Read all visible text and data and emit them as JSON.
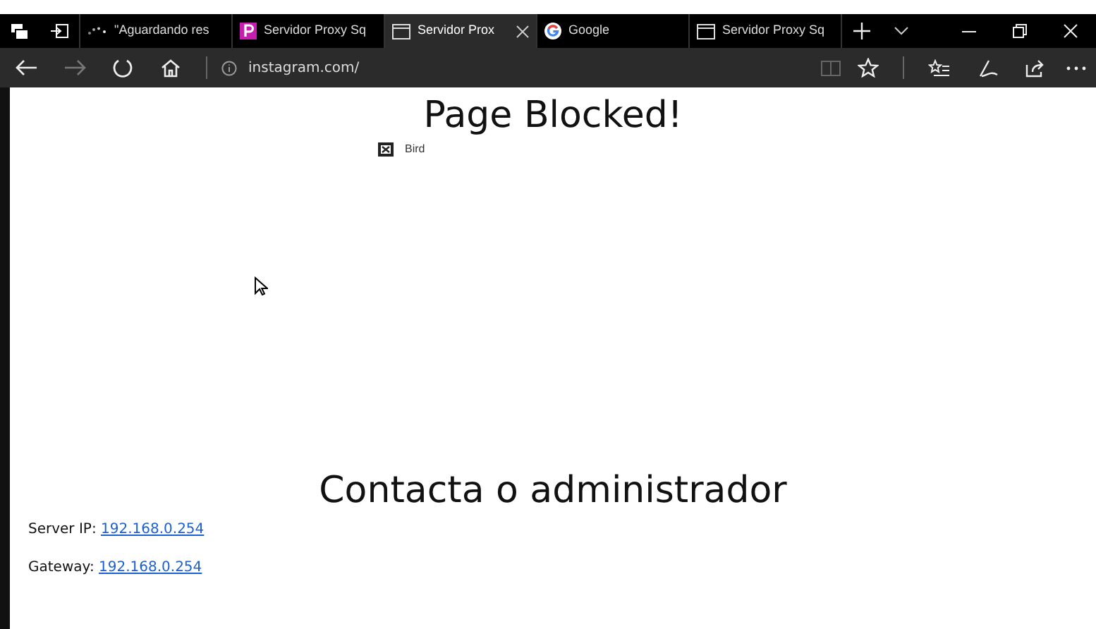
{
  "tabs": [
    {
      "title": "\"Aguardando res",
      "kind": "loading",
      "selected": false
    },
    {
      "title": "Servidor Proxy Sq",
      "kind": "p-logo",
      "selected": false
    },
    {
      "title": "Servidor Prox",
      "kind": "page",
      "selected": true
    },
    {
      "title": "Google",
      "kind": "google",
      "selected": false
    },
    {
      "title": "Servidor Proxy Sq",
      "kind": "page",
      "selected": false
    }
  ],
  "address": "instagram.com/",
  "page": {
    "heading": "Page Blocked!",
    "image_alt": "Bird",
    "subheading": "Contacta o administrador",
    "info": [
      {
        "label": "Server IP:",
        "link": "192.168.0.254"
      },
      {
        "label": "Gateway:",
        "link": "192.168.0.254"
      }
    ]
  }
}
